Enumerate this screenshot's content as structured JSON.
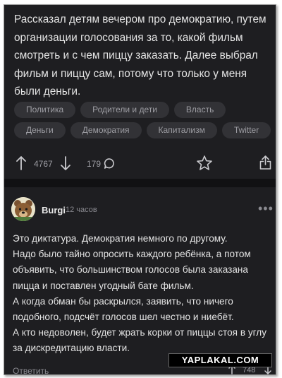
{
  "post": {
    "text": "Рассказал детям вечером про демократию, путем организации голосования за то, какой фильм смотреть и с чем пиццу заказать. Далее выбрал фильм и пиццу сам, потому что только у меня были деньги.",
    "tags": [
      "Политика",
      "Родители и дети",
      "Власть",
      "Деньги",
      "Демократия",
      "Капитализм",
      "Twitter"
    ],
    "upvotes": "4767",
    "comments_count": "179"
  },
  "comment": {
    "author": "Burgi",
    "time": "12 часов",
    "lines": [
      "Это диктатура. Демократия немного по другому.",
      "Надо было тайно опросить каждого ребёнка, а потом",
      "объявить, что большинством голосов была заказана",
      "пицца и поставлен угодный бате фильм.",
      "А когда обман бы раскрылся, заявить, что ничего",
      "подобного, подсчёт голосов шел честно и ниебёт.",
      "А кто недоволен, будет жрать корки от пиццы стоя в углу",
      "за дискредитацию власти."
    ],
    "reply_label": "Ответить",
    "rating": "748"
  },
  "watermark": "YAPLAKAL.COM"
}
